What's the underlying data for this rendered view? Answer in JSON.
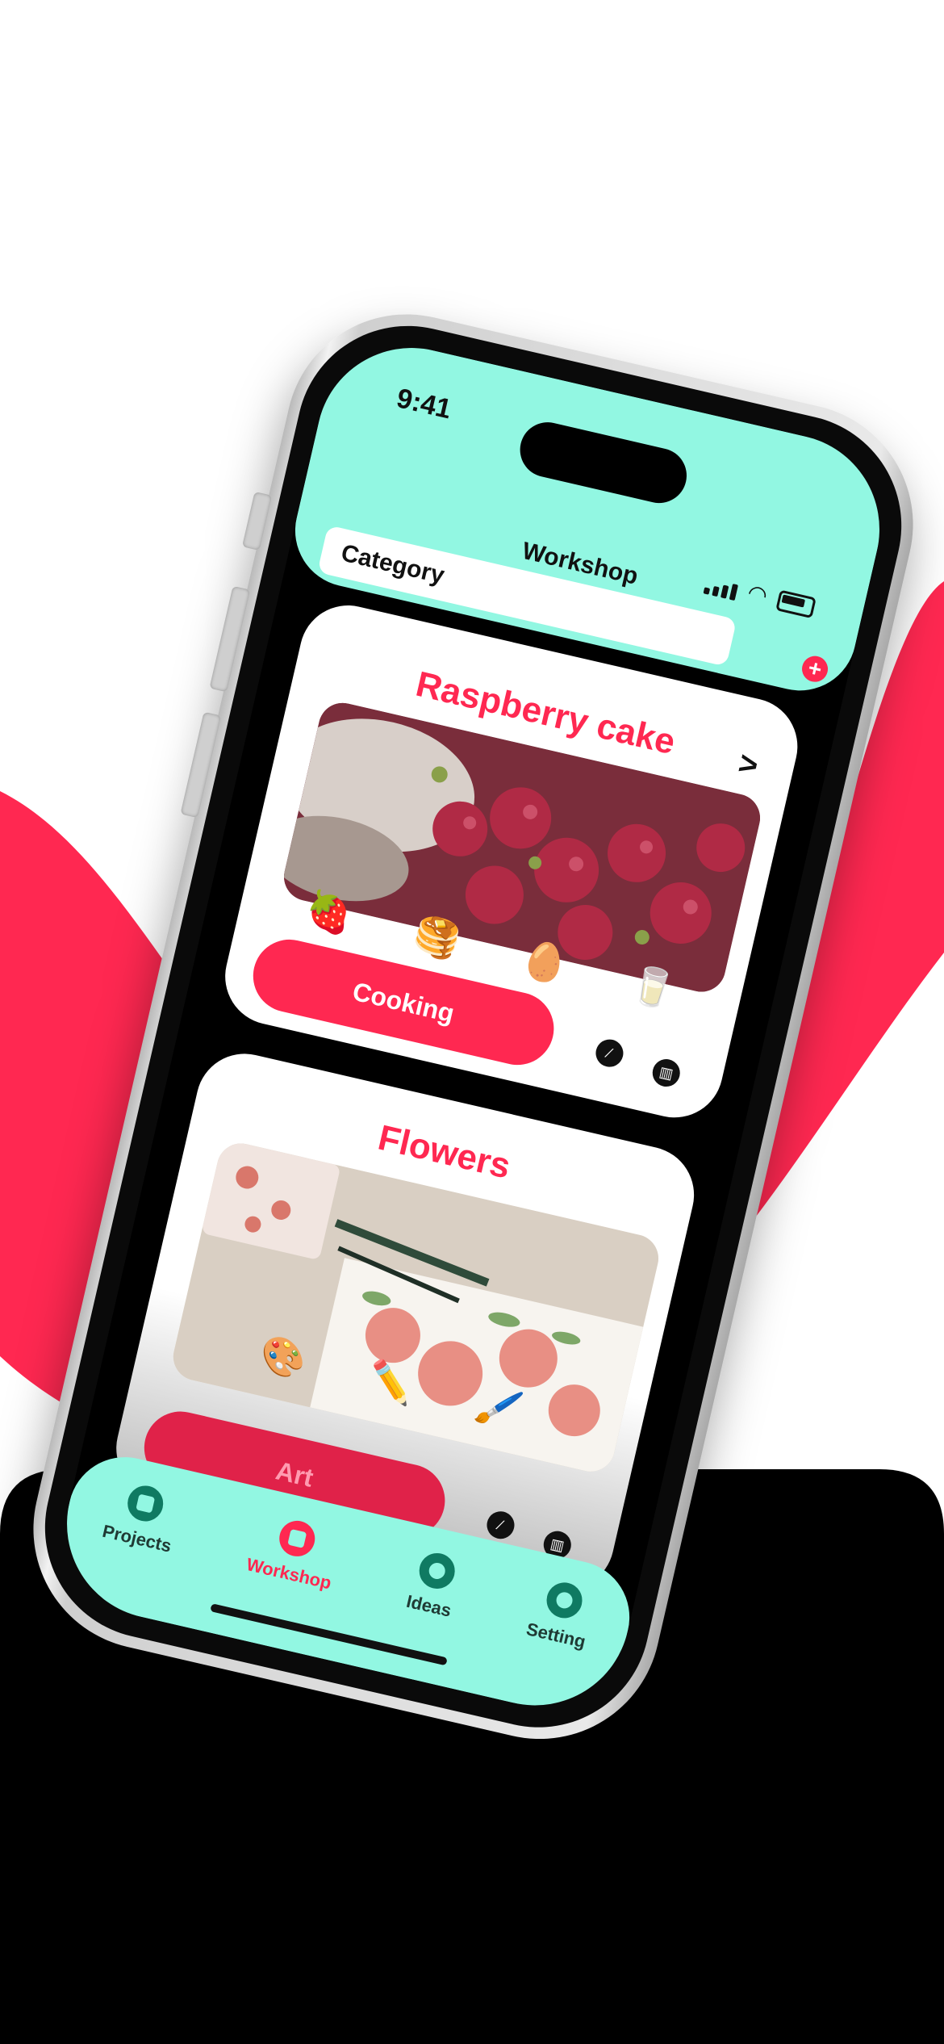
{
  "colors": {
    "accent": "#ff2851",
    "mint": "#92f7e2",
    "dark": "#000000"
  },
  "status_bar": {
    "time": "9:41"
  },
  "header": {
    "title": "Workshop",
    "category_label": "Category"
  },
  "cards": [
    {
      "title": "Raspberry cake",
      "emojis": [
        "🍓",
        "🥞",
        "🥚",
        "🥛"
      ],
      "button_label": "Cooking"
    },
    {
      "title": "Flowers",
      "emojis": [
        "🎨",
        "✏️",
        "🖌️"
      ],
      "button_label": "Art"
    }
  ],
  "tabs": [
    {
      "label": "Projects",
      "icon": "folder-icon"
    },
    {
      "label": "Workshop",
      "icon": "workshop-icon",
      "active": true
    },
    {
      "label": "Ideas",
      "icon": "lightbulb-icon"
    },
    {
      "label": "Setting",
      "icon": "gear-icon"
    }
  ]
}
